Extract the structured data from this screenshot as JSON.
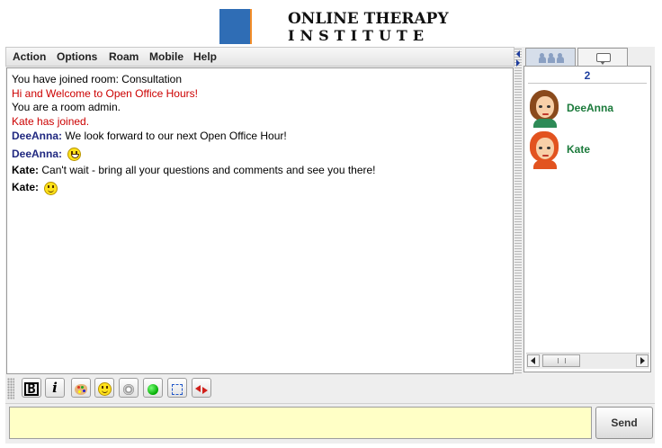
{
  "header": {
    "logo_line1": "ONLINE THERAPY",
    "logo_line2": "INSTITUTE"
  },
  "menu": {
    "items": [
      "Action",
      "Options",
      "Roam",
      "Mobile",
      "Help"
    ]
  },
  "chat": {
    "messages": [
      {
        "type": "system",
        "text": "You have joined room: Consultation"
      },
      {
        "type": "notice",
        "text": "Hi and Welcome to Open Office Hours!"
      },
      {
        "type": "system",
        "text": "You are a room admin."
      },
      {
        "type": "notice",
        "text": "Kate has joined."
      },
      {
        "type": "user",
        "author": "DeeAnna:",
        "text": "We look forward to our next Open Office Hour!"
      },
      {
        "type": "emoji",
        "author": "DeeAnna:",
        "emoji": "grin-smiley-icon"
      },
      {
        "type": "user",
        "author": "Kate:",
        "text": "Can't wait - bring all your questions and comments and see you there!"
      },
      {
        "type": "emoji",
        "author": "Kate:",
        "emoji": "smiley-icon"
      }
    ]
  },
  "users_panel": {
    "count": "2",
    "users": [
      {
        "name": "DeeAnna",
        "avatar": "avatar-brown-hair"
      },
      {
        "name": "Kate",
        "avatar": "avatar-red-hair"
      }
    ],
    "tabs": [
      "users-tab-icon",
      "chat-tab-icon"
    ]
  },
  "toolbar": {
    "buttons": [
      "bold-icon",
      "italic-icon",
      "palette-icon",
      "smiley-icon",
      "sound-icon",
      "status-green-icon",
      "fullscreen-icon",
      "arrows-icon"
    ],
    "bold_label": "B",
    "italic_label": "i"
  },
  "input": {
    "value": "",
    "send_label": "Send"
  },
  "colors": {
    "input_background": "#ffffc6",
    "notice_text": "#cc0000",
    "username_chat": "#202880",
    "username_list": "#1b7a3b"
  }
}
